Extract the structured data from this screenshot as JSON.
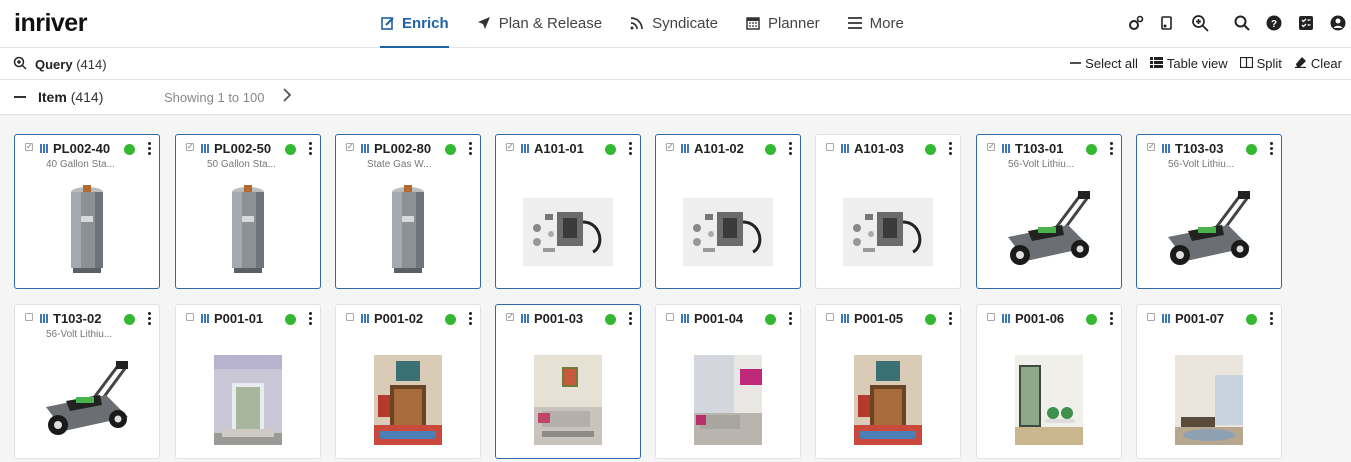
{
  "app": {
    "logo": "inriver"
  },
  "nav": [
    {
      "label": "Enrich",
      "icon": "edit-icon",
      "active": true
    },
    {
      "label": "Plan & Release",
      "icon": "send-icon",
      "active": false
    },
    {
      "label": "Syndicate",
      "icon": "wifi-icon",
      "active": false
    },
    {
      "label": "Planner",
      "icon": "calendar-icon",
      "active": false
    },
    {
      "label": "More",
      "icon": "menu-icon",
      "active": false
    }
  ],
  "top_icons": [
    "settings-gears-icon",
    "music-search-icon",
    "zoom-in-icon",
    "search-icon",
    "help-icon",
    "checklist-icon",
    "user-icon"
  ],
  "query": {
    "label": "Query",
    "count": "(414)"
  },
  "actions": [
    {
      "label": "Select all",
      "icon": "minus-icon"
    },
    {
      "label": "Table view",
      "icon": "list-icon"
    },
    {
      "label": "Split",
      "icon": "split-icon"
    },
    {
      "label": "Clear",
      "icon": "eraser-icon"
    }
  ],
  "item_header": {
    "title": "Item",
    "count": "(414)",
    "showing": "Showing 1 to 100"
  },
  "cards": [
    {
      "id": "PL002-40",
      "desc": "40 Gallon Sta...",
      "kind": "heater",
      "selected": true,
      "checked": true
    },
    {
      "id": "PL002-50",
      "desc": "50 Gallon Sta...",
      "kind": "heater",
      "selected": true,
      "checked": true
    },
    {
      "id": "PL002-80",
      "desc": "State Gas W...",
      "kind": "heater",
      "selected": true,
      "checked": true
    },
    {
      "id": "A101-01",
      "desc": "",
      "kind": "kit",
      "selected": true,
      "checked": true
    },
    {
      "id": "A101-02",
      "desc": "",
      "kind": "kit",
      "selected": true,
      "checked": true
    },
    {
      "id": "A101-03",
      "desc": "",
      "kind": "kit",
      "selected": false,
      "checked": false
    },
    {
      "id": "T103-01",
      "desc": "56-Volt Lithiu...",
      "kind": "mower",
      "selected": true,
      "checked": true
    },
    {
      "id": "T103-03",
      "desc": "56-Volt Lithiu...",
      "kind": "mower",
      "selected": true,
      "checked": true
    },
    {
      "id": "T103-02",
      "desc": "56-Volt Lithiu...",
      "kind": "mower",
      "selected": false,
      "checked": false
    },
    {
      "id": "P001-01",
      "desc": "",
      "kind": "room1",
      "selected": false,
      "checked": false
    },
    {
      "id": "P001-02",
      "desc": "",
      "kind": "room2",
      "selected": false,
      "checked": false
    },
    {
      "id": "P001-03",
      "desc": "",
      "kind": "room3",
      "selected": true,
      "checked": true
    },
    {
      "id": "P001-04",
      "desc": "",
      "kind": "room4",
      "selected": false,
      "checked": false
    },
    {
      "id": "P001-05",
      "desc": "",
      "kind": "room2",
      "selected": false,
      "checked": false
    },
    {
      "id": "P001-06",
      "desc": "",
      "kind": "room5",
      "selected": false,
      "checked": false
    },
    {
      "id": "P001-07",
      "desc": "",
      "kind": "room6",
      "selected": false,
      "checked": false
    }
  ],
  "colors": {
    "accent": "#1f63a5",
    "status_ok": "#35b831",
    "selected_border": "#2f6aa8"
  }
}
